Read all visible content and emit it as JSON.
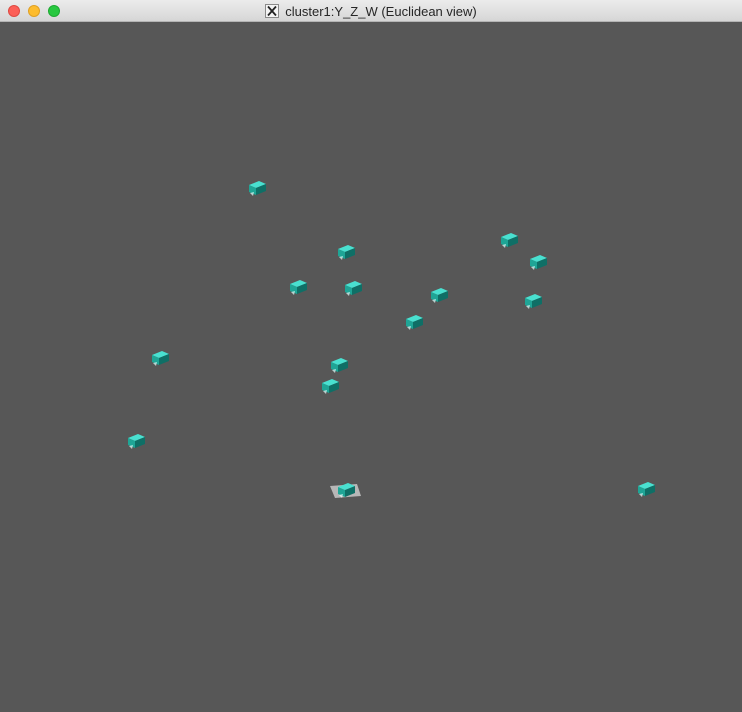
{
  "window": {
    "title": "cluster1:Y_Z_W (Euclidean view)",
    "title_icon": "x11-icon",
    "buttons": [
      "close",
      "minimize",
      "zoom"
    ]
  },
  "viewport": {
    "background": "#575757",
    "glyph_icon": "cube-icon",
    "glyph_color": "#2cc4b4",
    "highlight_color": "#c8c8c8"
  }
}
